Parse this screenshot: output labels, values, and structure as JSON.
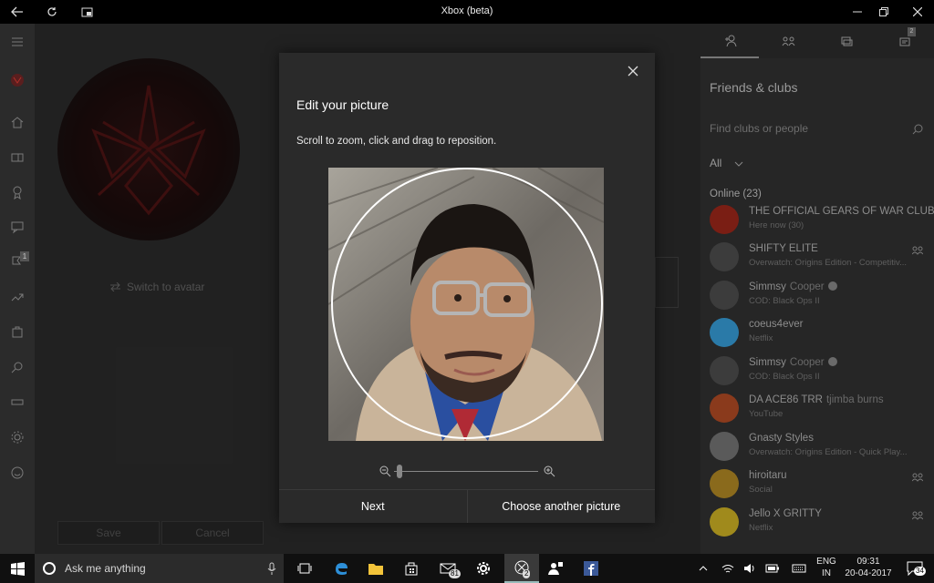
{
  "window": {
    "title": "Xbox (beta)",
    "controls": [
      "back-arrow-icon",
      "refresh-icon",
      "snap-icon",
      "minimize-icon",
      "restore-icon",
      "close-icon"
    ]
  },
  "left_rail": {
    "items": [
      "hamburger-menu-icon",
      "gamerpic-icon",
      "home-icon",
      "my-games-icon",
      "achievements-icon",
      "messages-icon",
      "activity-alerts-icon",
      "trending-icon",
      "store-icon",
      "search-icon",
      "connection-icon",
      "settings-icon",
      "feedback-icon"
    ],
    "alerts_badge": "1"
  },
  "profile_edit": {
    "switch_label": "Switch to avatar",
    "save_label": "Save",
    "cancel_label": "Cancel"
  },
  "dialog": {
    "title": "Edit your picture",
    "hint": "Scroll to zoom, click and drag to reposition.",
    "zoom_level": 0.02,
    "next_label": "Next",
    "choose_label": "Choose another picture"
  },
  "panel": {
    "tabs": [
      "friends-icon",
      "party-icon",
      "messages-icon",
      "notifications-icon"
    ],
    "notifications_badge": "2",
    "title": "Friends & clubs",
    "search_placeholder": "Find clubs or people",
    "filter_label": "All",
    "online_header": "Online (23)",
    "friends": [
      {
        "name": "THE OFFICIAL GEARS OF WAR CLUB",
        "real": "",
        "status": "Here now (30)",
        "color": "#7a1e14"
      },
      {
        "name": "SHIFTY ELITE",
        "real": "",
        "status": "Overwatch: Origins Edition - Competitiv...",
        "color": "#3c3c3c"
      },
      {
        "name": "Simmsy",
        "real": "Cooper",
        "status": "COD: Black Ops II",
        "color": "#3c3c3c"
      },
      {
        "name": "coeus4ever",
        "real": "",
        "status": "Netflix",
        "color": "#2a7aa8"
      },
      {
        "name": "Simmsy",
        "real": "Cooper",
        "status": "COD: Black Ops II",
        "color": "#3c3c3c"
      },
      {
        "name": "DA ACE86 TRR",
        "real": "tjimba burns",
        "status": "YouTube",
        "color": "#8a3a1c"
      },
      {
        "name": "Gnasty Styles",
        "real": "",
        "status": "Overwatch: Origins Edition - Quick Play...",
        "color": "#5a5a5a"
      },
      {
        "name": "hiroitaru",
        "real": "",
        "status": "Social",
        "color": "#8a6a1c"
      },
      {
        "name": "Jello X GRITTY",
        "real": "",
        "status": "Netflix",
        "color": "#a08a1c"
      }
    ]
  },
  "taskbar": {
    "search_text": "Ask me anything",
    "mail_count": "81",
    "xbox_count": "2",
    "lang_top": "ENG",
    "lang_bottom": "IN",
    "time": "09:31",
    "date": "20-04-2017",
    "notif_count": "34"
  },
  "colors": {
    "accent": "#107c10",
    "dialog_bg": "#2a2a2a",
    "panel_bg": "#262626"
  }
}
